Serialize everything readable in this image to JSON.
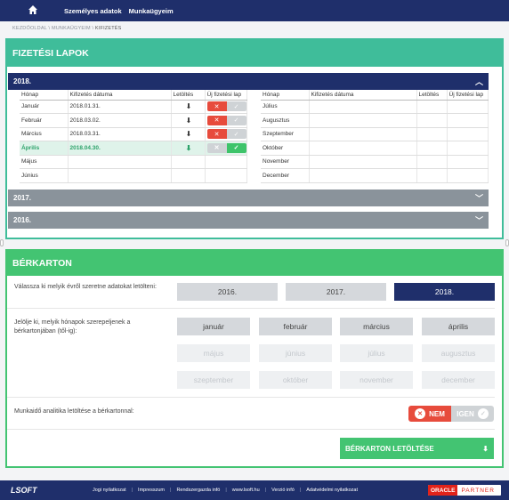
{
  "topbar": {
    "nav": [
      "Személyes adatok",
      "Munkaügyeim"
    ]
  },
  "breadcrumb": [
    "KEZDŐOLDAL",
    "MUNKAÜGYEIM",
    "KIFIZETÉS"
  ],
  "payslips": {
    "title": "FIZETÉSI LAPOK",
    "years": [
      "2018.",
      "2017.",
      "2016."
    ],
    "headers": [
      "Hónap",
      "Kifizetés dátuma",
      "Letöltés",
      "Új fizetési lap"
    ],
    "left_rows": [
      {
        "month": "Január",
        "date": "2018.01.31.",
        "download": true,
        "state": "no"
      },
      {
        "month": "Február",
        "date": "2018.03.02.",
        "download": true,
        "state": "no"
      },
      {
        "month": "Március",
        "date": "2018.03.31.",
        "download": true,
        "state": "no"
      },
      {
        "month": "Április",
        "date": "2018.04.30.",
        "download": true,
        "state": "yes"
      },
      {
        "month": "Május",
        "date": "",
        "download": false,
        "state": ""
      },
      {
        "month": "Június",
        "date": "",
        "download": false,
        "state": ""
      }
    ],
    "right_rows": [
      {
        "month": "Július"
      },
      {
        "month": "Augusztus"
      },
      {
        "month": "Szeptember"
      },
      {
        "month": "Október"
      },
      {
        "month": "November"
      },
      {
        "month": "December"
      }
    ]
  },
  "salary": {
    "title": "BÉRKARTON",
    "year_question": "Válassza ki melyik évről szeretne adatokat letölteni:",
    "years": [
      "2016.",
      "2017.",
      "2018."
    ],
    "month_question": "Jelölje ki, melyik hónapok szerepeljenek a bérkartonjában (től-ig):",
    "months": [
      "január",
      "február",
      "március",
      "április",
      "május",
      "június",
      "július",
      "augusztus",
      "szeptember",
      "október",
      "november",
      "december"
    ],
    "analytics_question": "Munkaidő analitika letöltése a bérkartonnal:",
    "no_label": "NEM",
    "yes_label": "IGEN",
    "download_label": "BÉRKARTON LETÖLTÉSE"
  },
  "footer": {
    "logo": "LSOFT",
    "links": [
      "Jogi nyilatkozat",
      "Impresszum",
      "Rendszergazda infó",
      "www.lsoft.hu",
      "Verzió infó",
      "Adatvédelmi nyilatkozat"
    ],
    "oracle": "ORACLE",
    "partner": "PARTNER"
  },
  "colors": {
    "navy": "#1f2f6b",
    "green": "#43c472",
    "red": "#e74b3c"
  }
}
